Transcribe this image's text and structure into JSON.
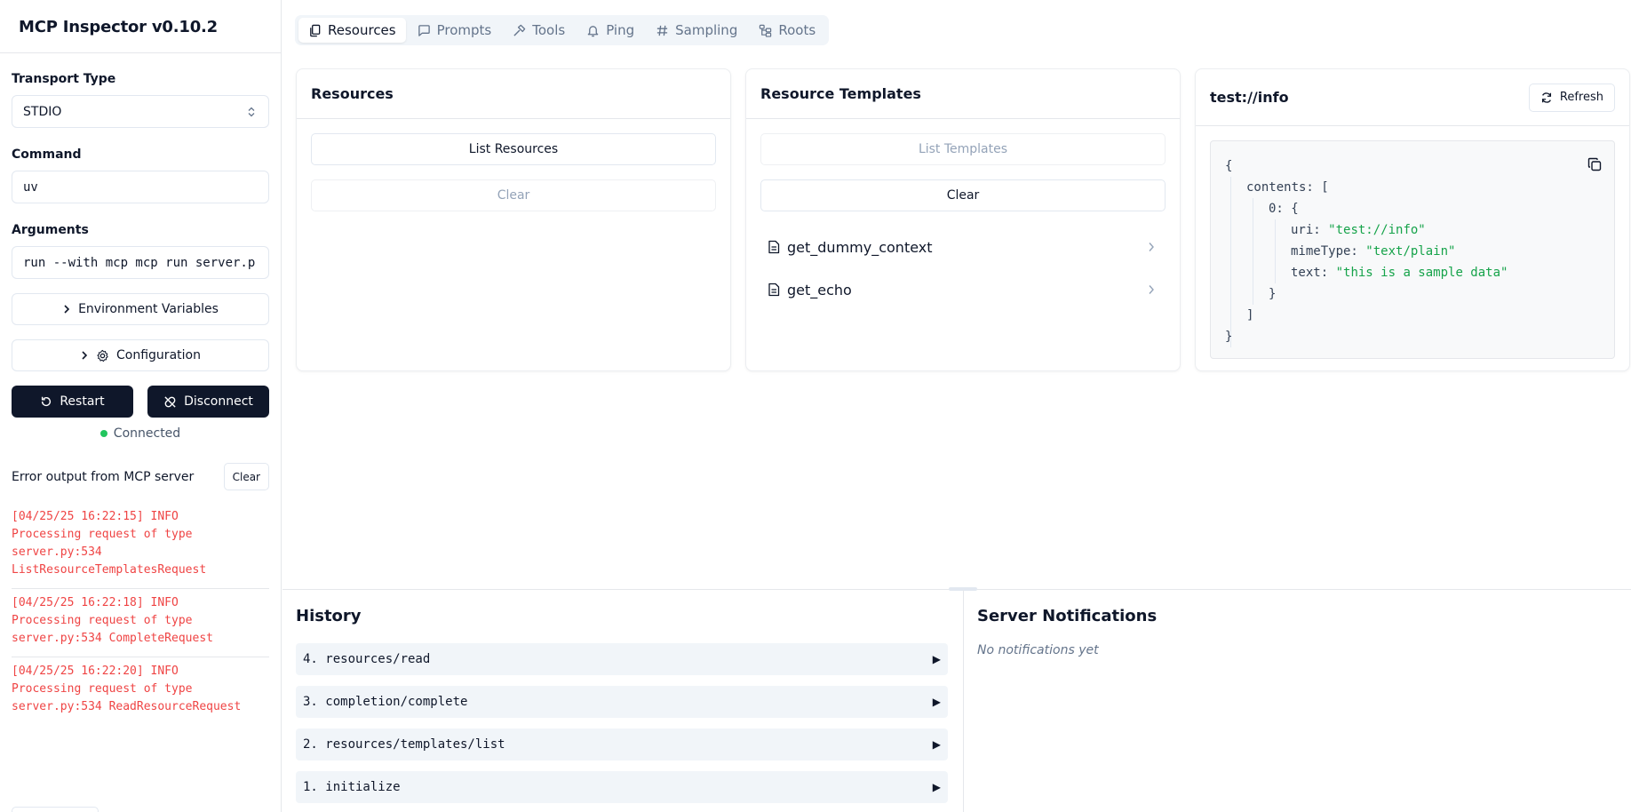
{
  "app": {
    "title": "MCP Inspector v0.10.2"
  },
  "sidebar": {
    "transport_label": "Transport Type",
    "transport_value": "STDIO",
    "command_label": "Command",
    "command_value": "uv",
    "arguments_label": "Arguments",
    "arguments_value": "run --with mcp mcp run server.p",
    "env_button": "Environment Variables",
    "config_button": "Configuration",
    "restart_button": "Restart",
    "disconnect_button": "Disconnect",
    "status": "Connected",
    "status_color": "#22c55e",
    "error_title": "Error output from MCP server",
    "error_clear": "Clear",
    "logs": [
      "[04/25/25 16:22:15] INFO\nProcessing request of type\nserver.py:534\nListResourceTemplatesRequest",
      "[04/25/25 16:22:18] INFO\nProcessing request of type\nserver.py:534 CompleteRequest",
      "[04/25/25 16:22:20] INFO\nProcessing request of type\nserver.py:534 ReadResourceRequest"
    ]
  },
  "tabs": [
    {
      "label": "Resources",
      "icon": "files-icon"
    },
    {
      "label": "Prompts",
      "icon": "message-icon"
    },
    {
      "label": "Tools",
      "icon": "hammer-icon"
    },
    {
      "label": "Ping",
      "icon": "bell-icon"
    },
    {
      "label": "Sampling",
      "icon": "hash-icon"
    },
    {
      "label": "Roots",
      "icon": "folder-tree-icon"
    }
  ],
  "resources_panel": {
    "title": "Resources",
    "list_button": "List Resources",
    "clear_button": "Clear"
  },
  "templates_panel": {
    "title": "Resource Templates",
    "list_button": "List Templates",
    "clear_button": "Clear",
    "items": [
      "get_dummy_context",
      "get_echo"
    ]
  },
  "detail_panel": {
    "title": "test://info",
    "refresh_button": "Refresh",
    "json": {
      "open": "{",
      "contents_key": "contents:",
      "contents_open": "[",
      "index_key": "0:",
      "index_open": "{",
      "uri_key": "uri:",
      "uri_value": "\"test://info\"",
      "mime_key": "mimeType:",
      "mime_value": "\"text/plain\"",
      "text_key": "text:",
      "text_value": "\"this is a sample data\"",
      "index_close": "}",
      "contents_close": "]",
      "close": "}"
    }
  },
  "history": {
    "title": "History",
    "items": [
      "4. resources/read",
      "3. completion/complete",
      "2. resources/templates/list",
      "1. initialize"
    ],
    "expand_glyph": "▶"
  },
  "notifications": {
    "title": "Server Notifications",
    "empty": "No notifications yet"
  }
}
